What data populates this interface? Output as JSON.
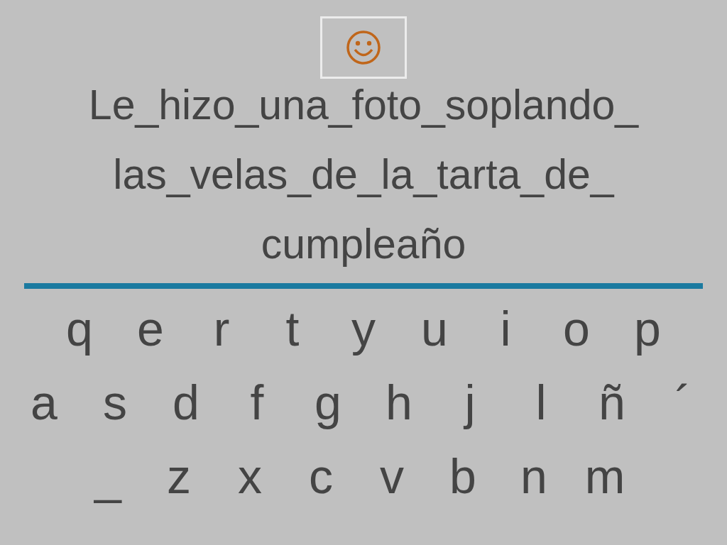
{
  "sentence_lines": [
    "Le_hizo_una_foto_soplando_",
    "las_velas_de_la_tarta_de_",
    "cumpleaño"
  ],
  "keyboard_rows": [
    [
      "q",
      "e",
      "r",
      "t",
      "y",
      "u",
      "i",
      "o",
      "p"
    ],
    [
      "a",
      "s",
      "d",
      "f",
      "g",
      "h",
      "j",
      "l",
      "ñ",
      "´"
    ],
    [
      "_",
      "z",
      "x",
      "c",
      "v",
      "b",
      "n",
      "m"
    ]
  ]
}
